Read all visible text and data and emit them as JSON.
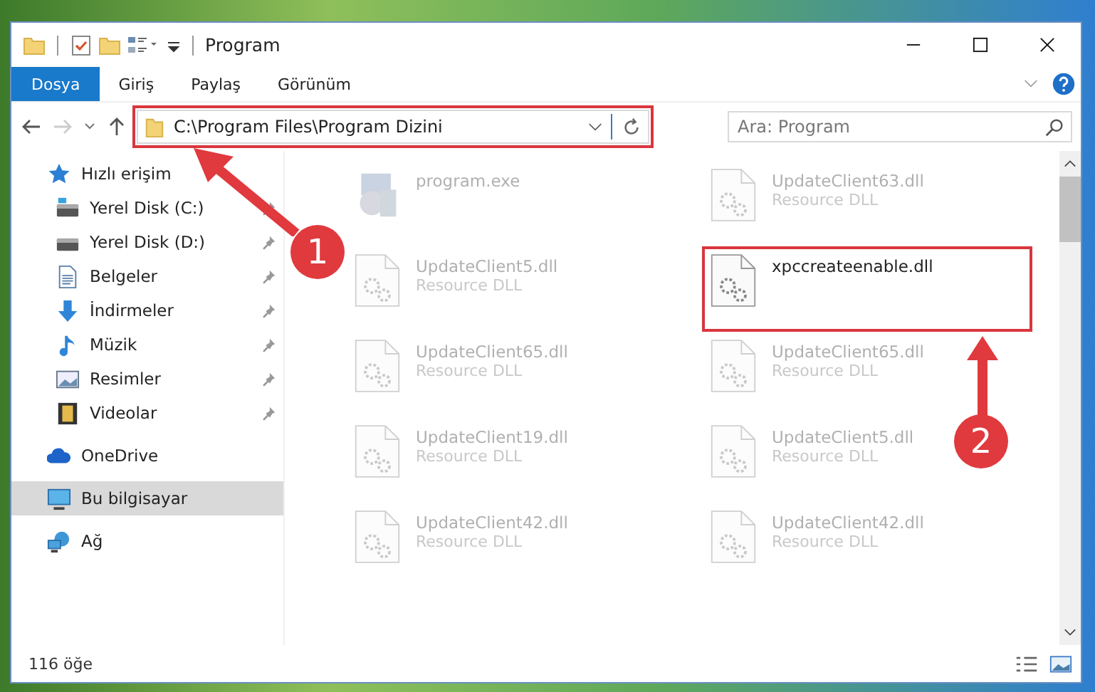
{
  "window": {
    "title": "Program"
  },
  "ribbon_tabs": [
    {
      "label": "Dosya",
      "selected": true
    },
    {
      "label": "Giriş",
      "selected": false
    },
    {
      "label": "Paylaş",
      "selected": false
    },
    {
      "label": "Görünüm",
      "selected": false
    }
  ],
  "address_bar": {
    "path": "C:\\Program Files\\Program Dizini",
    "highlighted": true
  },
  "search": {
    "placeholder": "Ara: Program"
  },
  "sidebar": {
    "items": [
      {
        "label": "Hızlı erişim",
        "kind": "star",
        "selected": false,
        "children": [
          {
            "label": "Yerel Disk (C:)",
            "kind": "drive-c",
            "pinned": true
          },
          {
            "label": "Yerel Disk (D:)",
            "kind": "drive",
            "pinned": true
          },
          {
            "label": "Belgeler",
            "kind": "doc",
            "pinned": true
          },
          {
            "label": "İndirmeler",
            "kind": "download",
            "pinned": true
          },
          {
            "label": "Müzik",
            "kind": "music",
            "pinned": true
          },
          {
            "label": "Resimler",
            "kind": "picture",
            "pinned": true
          },
          {
            "label": "Videolar",
            "kind": "video",
            "pinned": true
          }
        ]
      },
      {
        "label": "OneDrive",
        "kind": "cloud",
        "selected": false
      },
      {
        "label": "Bu bilgisayar",
        "kind": "pc",
        "selected": true
      },
      {
        "label": "Ağ",
        "kind": "network",
        "selected": false
      }
    ]
  },
  "files": [
    {
      "name": "program.exe",
      "kind": "exe",
      "highlighted": false
    },
    {
      "name": "UpdateClient63.dll",
      "type": "Resource DLL",
      "kind": "dll",
      "highlighted": false
    },
    {
      "name": "UpdateClient5.dll",
      "type": "Resource DLL",
      "kind": "dll",
      "highlighted": false
    },
    {
      "name": "xpccreateenable.dll",
      "kind": "dll",
      "highlighted": true
    },
    {
      "name": "UpdateClient65.dll",
      "type": "Resource DLL",
      "kind": "dll",
      "highlighted": false
    },
    {
      "name": "UpdateClient65.dll",
      "type": "Resource DLL",
      "kind": "dll",
      "highlighted": false
    },
    {
      "name": "UpdateClient19.dll",
      "type": "Resource DLL",
      "kind": "dll",
      "highlighted": false
    },
    {
      "name": "UpdateClient5.dll",
      "type": "Resource DLL",
      "kind": "dll",
      "highlighted": false
    },
    {
      "name": "UpdateClient42.dll",
      "type": "Resource DLL",
      "kind": "dll",
      "highlighted": false
    },
    {
      "name": "UpdateClient42.dll",
      "type": "Resource DLL",
      "kind": "dll",
      "highlighted": false
    }
  ],
  "annotations": [
    {
      "number": "1"
    },
    {
      "number": "2"
    }
  ],
  "status_bar": {
    "count": "116 öğe"
  }
}
